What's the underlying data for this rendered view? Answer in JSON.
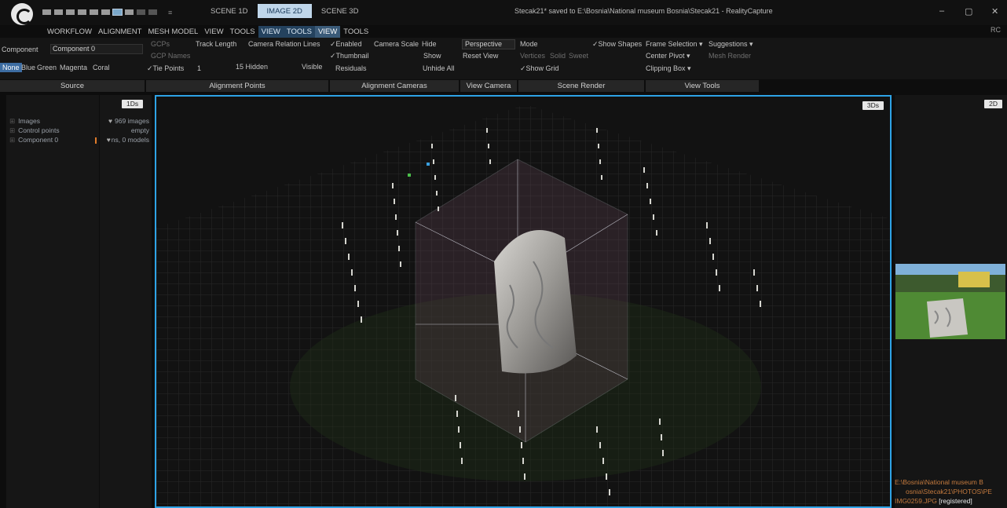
{
  "titlebar": {
    "quick_access": "≡",
    "scene_tabs": [
      "SCENE 1D",
      "IMAGE 2D",
      "SCENE 3D"
    ],
    "active_tab": 1,
    "window_title": "Stecak21* saved to E:\\Bosnia\\National museum Bosnia\\Stecak21 - RealityCapture",
    "minimize": "–",
    "restore": "▢",
    "close": "✕",
    "rc": "RC"
  },
  "menus": [
    "WORKFLOW",
    "ALIGNMENT",
    "MESH MODEL",
    "VIEW",
    "TOOLS",
    "VIEW",
    "TOOLS",
    "VIEW",
    "TOOLS"
  ],
  "ribbon": {
    "component_label": "Component",
    "component_value": "Component 0",
    "colors": {
      "none": "None",
      "blue": "Blue",
      "green": "Green",
      "magenta": "Magenta",
      "coral": "Coral"
    },
    "gcps": "GCPs",
    "gcp_names": "GCP Names",
    "tie_points": "✓Tie Points",
    "track_length": "Track Length",
    "track_value": "1",
    "camera_relation_lines": "Camera Relation Lines",
    "hidden": "15 Hidden",
    "visible": "Visible",
    "enabled": "✓Enabled",
    "thumbnail": "✓Thumbnail",
    "residuals": "Residuals",
    "camera_scale": "Camera Scale",
    "hide": "Hide",
    "show": "Show",
    "unhide_all": "Unhide All",
    "perspective": "Perspective",
    "reset_view": "Reset View",
    "mode": "Mode",
    "vertices": "Vertices",
    "solid": "Solid",
    "sweet": "Sweet",
    "show_grid": "✓Show Grid",
    "show_shapes": "✓Show Shapes",
    "frame_selection": "Frame Selection ▾",
    "suggestions": "Suggestions ▾",
    "center_pivot": "Center Pivot ▾",
    "mesh_render": "Mesh Render",
    "clipping_box": "Clipping Box ▾"
  },
  "sections": [
    "Source",
    "Alignment Points",
    "Alignment Cameras",
    "View Camera",
    "Scene Render",
    "View Tools"
  ],
  "left_panel": {
    "badge": "1Ds",
    "tree": [
      "Images",
      "Control points",
      "Component 0"
    ],
    "info": [
      "969 images",
      "empty",
      "ns, 0 models"
    ]
  },
  "viewport": {
    "badge": "3Ds"
  },
  "right_panel": {
    "badge": "2D",
    "path_line1": "E:\\Bosnia\\National museum B",
    "path_line2": "osnia\\Stecak21\\PHOTOS\\PE",
    "file": "IMG0259.JPG",
    "status": "[registered]"
  }
}
